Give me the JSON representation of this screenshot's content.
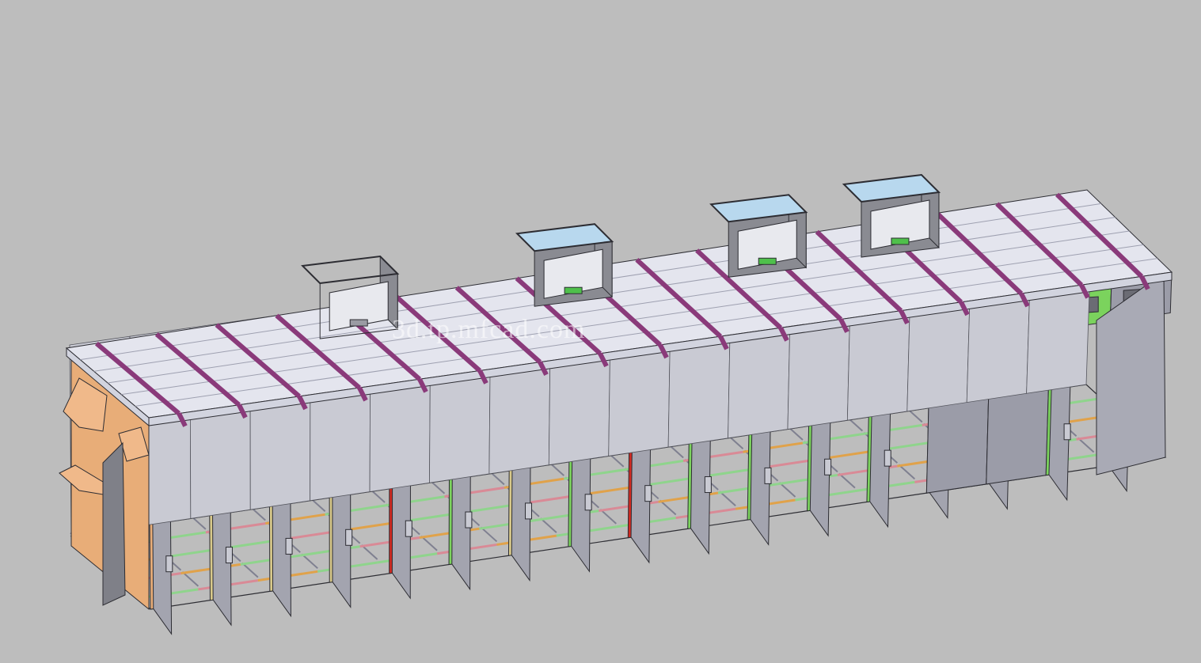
{
  "watermark": "3d.tp.mfcad.com",
  "colors": {
    "background": "#bdbdbd",
    "roof": "#e4e5ee",
    "roof_side": "#d2d4df",
    "roof_rib": "#9ea0b0",
    "strap": "#8a3a7a",
    "frame_outline": "#2d2d33",
    "panel_gray": "#9b9ca8",
    "door_gray": "#a3a4af",
    "rail_pink": "#d98a96",
    "rail_orange": "#e0a24a",
    "rail_green": "#8fd48c",
    "orange_wall": "#e8ad78",
    "tan": "#d8c98a",
    "green": "#7bd35d",
    "red": "#cf2a22",
    "unit_glass": "#b8d8ee",
    "unit_body": "#8a8b92"
  },
  "bays": [
    {
      "color": "orange"
    },
    {
      "color": "tan"
    },
    {
      "color": "tan"
    },
    {
      "color": "tan"
    },
    {
      "color": "red"
    },
    {
      "color": "green"
    },
    {
      "color": "tan"
    },
    {
      "color": "green"
    },
    {
      "color": "red"
    },
    {
      "color": "green"
    },
    {
      "color": "green"
    },
    {
      "color": "green"
    },
    {
      "color": "green"
    },
    {
      "color": "tan"
    },
    {
      "color": "tan"
    },
    {
      "color": "green"
    },
    {
      "color": "plain"
    }
  ],
  "roof_units": [
    {
      "style": "open-frame"
    },
    {
      "style": "glass-top"
    },
    {
      "style": "glass-top"
    },
    {
      "style": "glass-top"
    }
  ]
}
